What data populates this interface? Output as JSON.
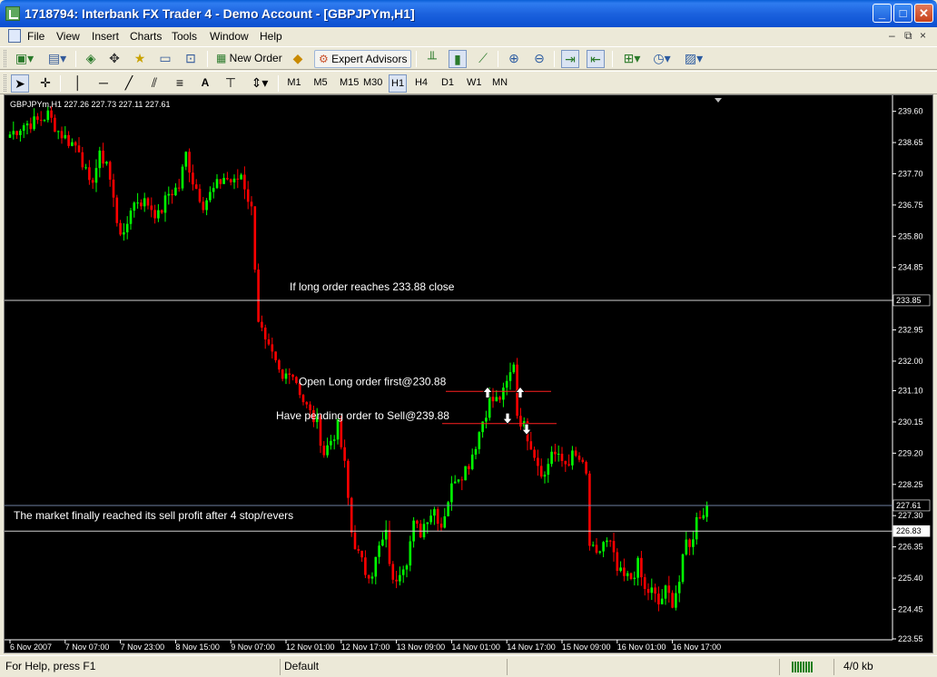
{
  "window": {
    "title": "1718794: Interbank FX Trader 4 - Demo Account - [GBPJPYm,H1]",
    "controls": {
      "minimize": "_",
      "maximize": "□",
      "close": "✕"
    }
  },
  "menu": {
    "items": [
      "File",
      "View",
      "Insert",
      "Charts",
      "Tools",
      "Window",
      "Help"
    ],
    "mdi_controls": {
      "minimize": "–",
      "restore": "⧉",
      "close": "×"
    }
  },
  "toolbar": {
    "new_order_label": "New Order",
    "expert_advisors_label": "Expert Advisors",
    "timeframes": [
      "M1",
      "M5",
      "M15",
      "M30",
      "H1",
      "H4",
      "D1",
      "W1",
      "MN"
    ],
    "active_timeframe": "H1",
    "text_tool": "A"
  },
  "chart": {
    "info": "GBPJPYm,H1  227.26 227.73 227.11 227.61",
    "background": "#000000",
    "bull_color": "#00ff00",
    "bear_color": "#ff0000",
    "current_price": "227.61",
    "annotations": {
      "close_long": "If long order reaches 233.88 close",
      "open_long": "Open Long order first@230.88",
      "pending_sell": "Have pending order to Sell@239.88",
      "result": "The market finally reached its sell profit after 4 stop/revers"
    },
    "hlines": {
      "close_level": "233.85",
      "bottom_level": "226.83"
    }
  },
  "chart_data": {
    "type": "candlestick",
    "symbol": "GBPJPYm",
    "timeframe": "H1",
    "ylim": [
      223.55,
      239.95
    ],
    "y_ticks": [
      "239.60",
      "238.65",
      "237.70",
      "236.75",
      "235.80",
      "234.85",
      "233.85",
      "232.95",
      "232.00",
      "231.10",
      "230.15",
      "229.20",
      "228.25",
      "227.30",
      "226.35",
      "225.40",
      "224.45",
      "223.55"
    ],
    "x_ticks": [
      "6 Nov 2007",
      "7 Nov 07:00",
      "7 Nov 23:00",
      "8 Nov 15:00",
      "9 Nov 07:00",
      "12 Nov 01:00",
      "12 Nov 17:00",
      "13 Nov 09:00",
      "14 Nov 01:00",
      "14 Nov 17:00",
      "15 Nov 09:00",
      "16 Nov 01:00",
      "16 Nov 17:00"
    ],
    "last_ohlc": {
      "open": 227.26,
      "high": 227.73,
      "low": 227.11,
      "close": 227.61
    },
    "anchors": [
      [
        0,
        238.9
      ],
      [
        4,
        239.2
      ],
      [
        8,
        239.3
      ],
      [
        11,
        239.5
      ],
      [
        14,
        239.0
      ],
      [
        17,
        238.7
      ],
      [
        20,
        238.5
      ],
      [
        23,
        237.3
      ],
      [
        26,
        238.2
      ],
      [
        28,
        238.1
      ],
      [
        31,
        236.3
      ],
      [
        33,
        235.7
      ],
      [
        35,
        236.7
      ],
      [
        37,
        236.9
      ],
      [
        40,
        236.8
      ],
      [
        43,
        236.4
      ],
      [
        46,
        237.1
      ],
      [
        49,
        237.3
      ],
      [
        51,
        238.3
      ],
      [
        53,
        237.5
      ],
      [
        56,
        236.8
      ],
      [
        59,
        237.2
      ],
      [
        62,
        237.6
      ],
      [
        65,
        237.4
      ],
      [
        67,
        237.7
      ],
      [
        70,
        236.6
      ],
      [
        72,
        233.3
      ],
      [
        74,
        232.5
      ],
      [
        76,
        232.1
      ],
      [
        79,
        231.4
      ],
      [
        81,
        231.8
      ],
      [
        83,
        231.4
      ],
      [
        85,
        230.8
      ],
      [
        87,
        230.4
      ],
      [
        89,
        230.1
      ],
      [
        91,
        229.2
      ],
      [
        93,
        229.6
      ],
      [
        95,
        230.0
      ],
      [
        97,
        228.8
      ],
      [
        99,
        226.8
      ],
      [
        101,
        226.1
      ],
      [
        103,
        225.6
      ],
      [
        105,
        225.6
      ],
      [
        107,
        226.3
      ],
      [
        109,
        226.7
      ],
      [
        111,
        225.2
      ],
      [
        113,
        225.7
      ],
      [
        115,
        226.0
      ],
      [
        117,
        227.0
      ],
      [
        119,
        226.8
      ],
      [
        121,
        227.3
      ],
      [
        123,
        227.5
      ],
      [
        125,
        227.0
      ],
      [
        127,
        227.8
      ],
      [
        129,
        228.5
      ],
      [
        131,
        228.6
      ],
      [
        133,
        228.9
      ],
      [
        135,
        229.5
      ],
      [
        137,
        230.2
      ],
      [
        139,
        230.8
      ],
      [
        141,
        230.8
      ],
      [
        143,
        231.0
      ],
      [
        145,
        231.6
      ],
      [
        146,
        232.0
      ],
      [
        147,
        230.4
      ],
      [
        149,
        230.0
      ],
      [
        151,
        229.5
      ],
      [
        153,
        228.9
      ],
      [
        155,
        228.5
      ],
      [
        157,
        229.3
      ],
      [
        159,
        229.0
      ],
      [
        161,
        228.9
      ],
      [
        163,
        229.1
      ],
      [
        165,
        229.0
      ],
      [
        167,
        228.5
      ],
      [
        168,
        226.4
      ],
      [
        170,
        226.0
      ],
      [
        172,
        226.5
      ],
      [
        174,
        226.4
      ],
      [
        176,
        225.6
      ],
      [
        178,
        225.4
      ],
      [
        180,
        225.4
      ],
      [
        182,
        225.8
      ],
      [
        184,
        225.0
      ],
      [
        186,
        225.0
      ],
      [
        188,
        224.6
      ],
      [
        190,
        225.0
      ],
      [
        192,
        224.7
      ],
      [
        194,
        225.3
      ],
      [
        196,
        226.5
      ],
      [
        198,
        226.5
      ],
      [
        199,
        227.4
      ],
      [
        201,
        227.3
      ],
      [
        202,
        227.61
      ]
    ]
  },
  "status": {
    "help": "For Help, press F1",
    "profile": "Default",
    "traffic": "4/0 kb"
  }
}
